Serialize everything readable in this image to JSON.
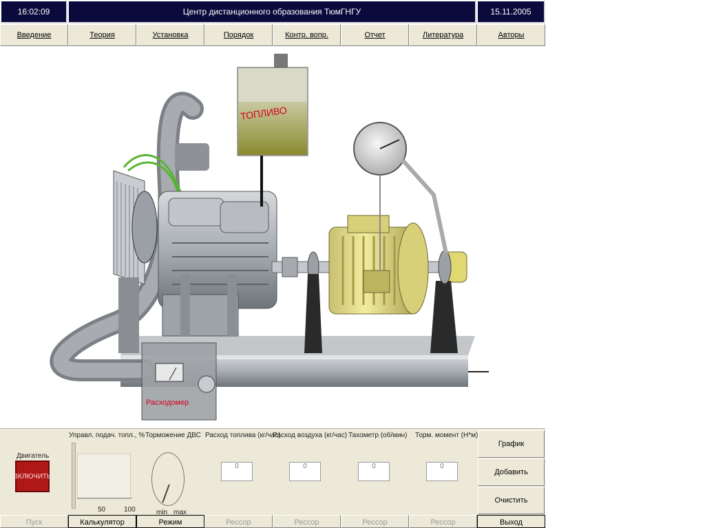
{
  "header": {
    "time": "16:02:09",
    "title": "Центр дистанционного образования ТюмГНГУ",
    "date": "15.11.2005"
  },
  "menu": [
    "Введение",
    "Теория",
    "Установка",
    "Порядок",
    "Контр. вопр.",
    "Отчет",
    "Литература",
    "Авторы"
  ],
  "scene": {
    "fuel_label": "ТОПЛИВО",
    "flowmeter_label": "Расходомер"
  },
  "panel": {
    "engine_label": "Двигатель",
    "engine_button": "ВКЛЮЧИТЬ",
    "fuel_control_label": "Управл. подач. топл., %",
    "scale_50": "50",
    "scale_100": "100",
    "brake_label": "Торможение ДВС",
    "brake_min": "min",
    "brake_max": "max",
    "fuel_rate_label": "Расход топлива (кг/час)",
    "fuel_rate_value": "0",
    "air_rate_label": "Расход воздуха (кг/час)",
    "air_rate_value": "0",
    "tacho_label": "Тахометр (об/мин)",
    "tacho_value": "0",
    "torque_label": "Торм. момент (Н*м)",
    "torque_value": "0",
    "graph_button": "График",
    "add_button": "Добавить",
    "clear_button": "Очистить"
  },
  "bottom_bar": [
    "Пуск",
    "Калькулятор",
    "Режим",
    "Рессор",
    "Рессор",
    "Рессор",
    "Рессор",
    "Выход"
  ],
  "colors": {
    "title_bg": "#0a0a3c",
    "panel_bg": "#ece9d8",
    "motor": "#e6e08a",
    "engine_button": "#b01818"
  }
}
